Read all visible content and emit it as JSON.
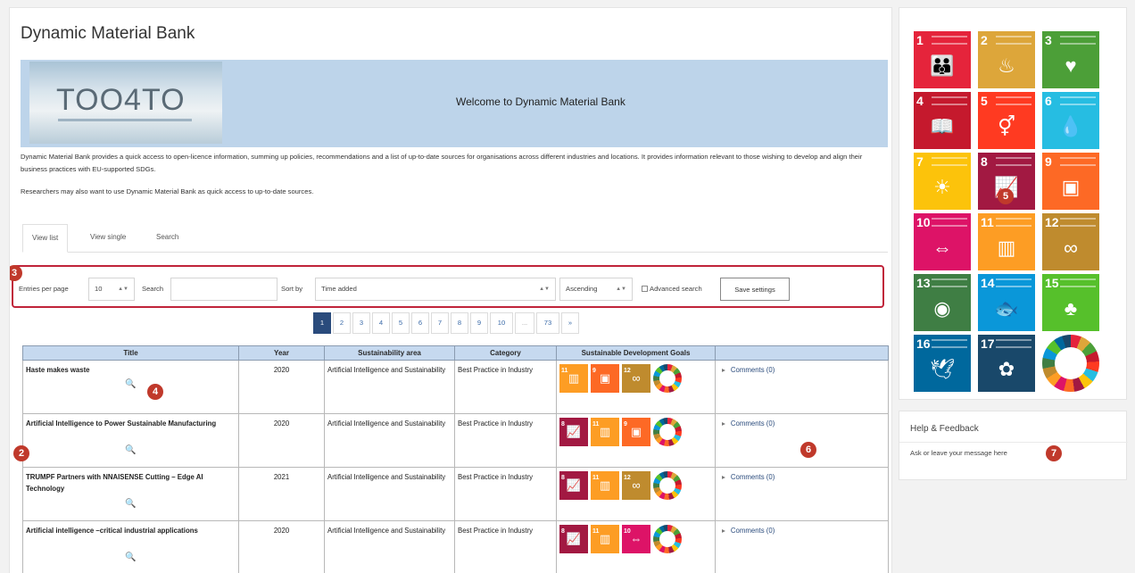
{
  "page": {
    "title": "Dynamic Material Bank",
    "banner_welcome": "Welcome to Dynamic Material Bank",
    "logo_text": "TOO4TO",
    "intro_1": "Dynamic Material Bank provides a quick access to open-licence information, summing up policies, recommendations and a list of up-to-date sources for organisations across different industries and locations. It provides information relevant to those wishing to develop and align their business practices with EU-supported SDGs.",
    "intro_2": "Researchers may also want to use Dynamic Material Bank as quick access to up-to-date sources."
  },
  "tabs": [
    {
      "label": "View list",
      "active": true
    },
    {
      "label": "View single",
      "active": false
    },
    {
      "label": "Search",
      "active": false
    }
  ],
  "controls": {
    "entries_label": "Entries per page",
    "entries_value": "10",
    "search_label": "Search",
    "search_value": "",
    "sort_label": "Sort by",
    "sort_value": "Time added",
    "order_value": "Ascending",
    "advanced_label": "Advanced search",
    "save_label": "Save settings"
  },
  "pager": {
    "pages": [
      "1",
      "2",
      "3",
      "4",
      "5",
      "6",
      "7",
      "8",
      "9",
      "10"
    ],
    "current": "1",
    "ellipsis": "...",
    "last": "73",
    "next": "»"
  },
  "table": {
    "headers": [
      "Title",
      "Year",
      "Sustainability area",
      "Category",
      "Sustainable Development Goals",
      ""
    ],
    "comments_label": "Comments (0)",
    "rows": [
      {
        "title": "Haste makes waste",
        "year": "2020",
        "area": "Artificial Intelligence and Sustainability",
        "category": "Best Practice in Industry",
        "sdgs": [
          "11",
          "9",
          "12",
          "all"
        ],
        "comments": "Comments (0)"
      },
      {
        "title": "Artificial Intelligence to Power Sustainable Manufacturing",
        "year": "2020",
        "area": "Artificial Intelligence and Sustainability",
        "category": "Best Practice in Industry",
        "sdgs": [
          "8",
          "11",
          "9",
          "all"
        ],
        "comments": "Comments (0)"
      },
      {
        "title": "TRUMPF Partners with NNAISENSE Cutting – Edge AI Technology",
        "year": "2021",
        "area": "Artificial Intelligence and Sustainability",
        "category": "Best Practice in Industry",
        "sdgs": [
          "8",
          "11",
          "12",
          "all"
        ],
        "comments": "Comments (0)"
      },
      {
        "title": "Artificial intelligence –critical industrial applications",
        "year": "2020",
        "area": "Artificial Intelligence and Sustainability",
        "category": "Best Practice in Industry",
        "sdgs": [
          "8",
          "11",
          "10",
          "all"
        ],
        "comments": "Comments (0)"
      }
    ]
  },
  "sdg_panel": {
    "tiles": [
      {
        "n": "1",
        "color": "#e5243b",
        "icon": "family-icon",
        "glyph": "👪"
      },
      {
        "n": "2",
        "color": "#dda63a",
        "icon": "bowl-icon",
        "glyph": "♨"
      },
      {
        "n": "3",
        "color": "#4c9f38",
        "icon": "heartbeat-icon",
        "glyph": "♥"
      },
      {
        "n": "4",
        "color": "#c5192d",
        "icon": "book-icon",
        "glyph": "📖"
      },
      {
        "n": "5",
        "color": "#ff3a21",
        "icon": "gender-icon",
        "glyph": "⚥"
      },
      {
        "n": "6",
        "color": "#26bde2",
        "icon": "water-icon",
        "glyph": "💧"
      },
      {
        "n": "7",
        "color": "#fcc30b",
        "icon": "sun-icon",
        "glyph": "☀"
      },
      {
        "n": "8",
        "color": "#a21942",
        "icon": "growth-chart-icon",
        "glyph": "📈"
      },
      {
        "n": "9",
        "color": "#fd6925",
        "icon": "cubes-icon",
        "glyph": "▣"
      },
      {
        "n": "10",
        "color": "#dd1367",
        "icon": "equality-icon",
        "glyph": "⇔"
      },
      {
        "n": "11",
        "color": "#fd9d24",
        "icon": "city-icon",
        "glyph": "▥"
      },
      {
        "n": "12",
        "color": "#bf8b2e",
        "icon": "infinity-icon",
        "glyph": "∞"
      },
      {
        "n": "13",
        "color": "#3f7e44",
        "icon": "eye-globe-icon",
        "glyph": "◉"
      },
      {
        "n": "14",
        "color": "#0a97d9",
        "icon": "fish-icon",
        "glyph": "🐟"
      },
      {
        "n": "15",
        "color": "#56c02b",
        "icon": "tree-icon",
        "glyph": "♣"
      },
      {
        "n": "16",
        "color": "#00689d",
        "icon": "dove-icon",
        "glyph": "🕊"
      },
      {
        "n": "17",
        "color": "#19486a",
        "icon": "flower-icon",
        "glyph": "✿"
      }
    ]
  },
  "help": {
    "title": "Help & Feedback",
    "text": "Ask or leave your message here"
  },
  "markers": [
    "2",
    "3",
    "4",
    "5",
    "6",
    "7"
  ]
}
